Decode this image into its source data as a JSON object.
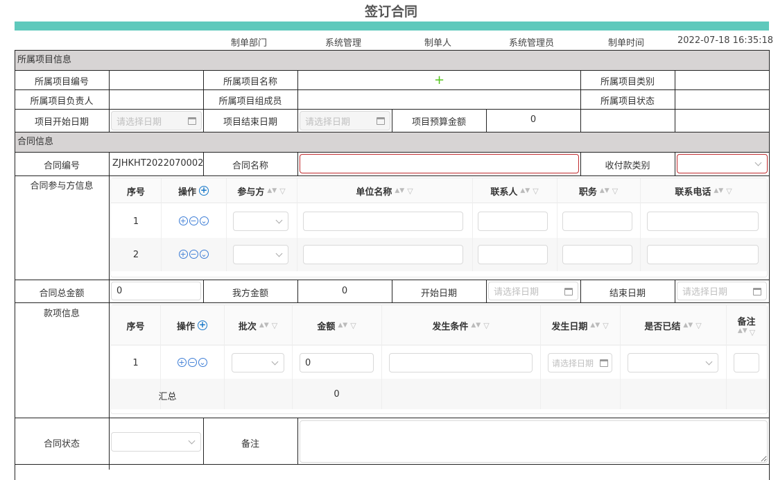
{
  "title": "签订合同",
  "meta": {
    "dept_label": "制单部门",
    "dept_value": "系统管理",
    "maker_label": "制单人",
    "maker_value": "系统管理员",
    "time_label": "制单时间",
    "time_value": "2022-07-18 16:35:18"
  },
  "project_section": {
    "title": "所属项目信息",
    "code_label": "所属项目编号",
    "name_label": "所属项目名称",
    "type_label": "所属项目类别",
    "leader_label": "所属项目负责人",
    "members_label": "所属项目组成员",
    "status_label": "所属项目状态",
    "start_label": "项目开始日期",
    "end_label": "项目结束日期",
    "budget_label": "项目预算金额",
    "budget_value": "0",
    "date_placeholder": "请选择日期"
  },
  "contract_section": {
    "title": "合同信息",
    "code_label": "合同编号",
    "code_value": "ZJHKHT2022070002",
    "name_label": "合同名称",
    "pay_type_label": "收付款类别",
    "parties_label": "合同参与方信息",
    "total_label": "合同总金额",
    "total_value": "0",
    "our_amount_label": "我方金额",
    "our_amount_value": "0",
    "start_label": "开始日期",
    "end_label": "结束日期",
    "date_placeholder": "请选择日期",
    "payment_label": "款项信息",
    "status_label": "合同状态",
    "remark_label": "备注"
  },
  "parties_table": {
    "headers": [
      "序号",
      "操作",
      "参与方",
      "单位名称",
      "联系人",
      "职务",
      "联系电话"
    ],
    "rows": [
      {
        "no": "1"
      },
      {
        "no": "2"
      }
    ]
  },
  "payment_table": {
    "headers": [
      "序号",
      "操作",
      "批次",
      "金额",
      "发生条件",
      "发生日期",
      "是否已结",
      "备注"
    ],
    "rows": [
      {
        "no": "1",
        "amount": "0",
        "date_placeholder": "请选择日期"
      }
    ],
    "summary_label": "汇总",
    "summary_amount": "0"
  },
  "colors": {
    "accent": "#5fc9bc",
    "section_bg": "#d7d4d4",
    "error_border": "#c0292c",
    "icon_blue": "#1677c8",
    "add_green": "#52c41a"
  }
}
